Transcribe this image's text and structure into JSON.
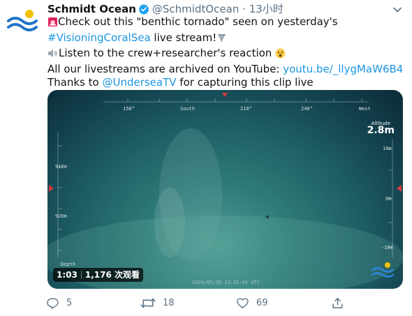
{
  "tweet": {
    "display_name": "Schmidt Ocean",
    "handle": "@SchmidtOcean",
    "dot": "·",
    "time": "13小时",
    "lines": {
      "l1_text": "Check out this \"benthic tornado\" seen on yesterday's",
      "l2_hashtag": "#VisioningCoralSea",
      "l2_text": " live stream!",
      "l3_text": "Listen to the crew+researcher's reaction ",
      "l4_text": "All our livestreams are archived on YouTube: ",
      "l4_link": "youtu.be/_llygMaW6B4",
      "l5_text": "Thanks to ",
      "l5_mention": "@UnderseaTV",
      "l5_text2": " for capturing this clip live"
    },
    "emoji": {
      "l1": "siren-emoji",
      "l2": "tornado-emoji",
      "l3a": "speaker-emoji",
      "l3b": "surprised-face-emoji"
    }
  },
  "video": {
    "heading_ticks": [
      "150°",
      "South",
      "210°",
      "240°",
      "West"
    ],
    "depth_left": [
      "910m",
      "920m"
    ],
    "depth_label": "Depth",
    "altitude_label": "Altitude",
    "altitude_value": "2.8m",
    "altitude_ticks": [
      "10m",
      "0m",
      "-10m"
    ],
    "timestamp": "2020/05/29 13:35:45 UTC",
    "duration": "1:03",
    "views": "1,176 次观看"
  },
  "actions": {
    "replies": "5",
    "retweets": "18",
    "likes": "69"
  },
  "colors": {
    "link": "#1b95e0",
    "verified": "#1da1f2",
    "muted": "#5b7083",
    "hud_red": "#d9383f"
  }
}
